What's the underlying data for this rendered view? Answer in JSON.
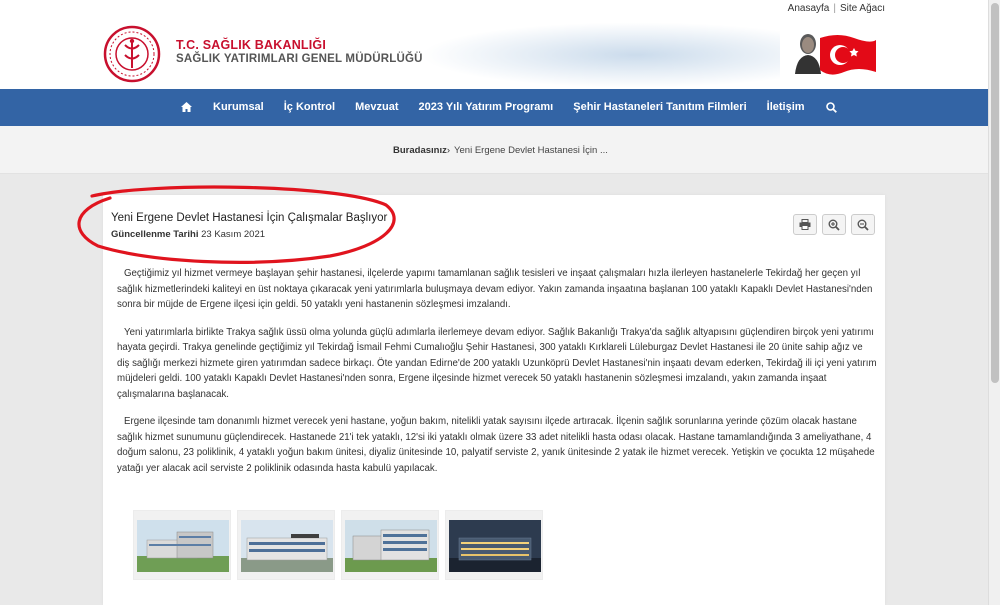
{
  "top_links": {
    "home": "Anasayfa",
    "sitemap": "Site Ağacı"
  },
  "brand": {
    "line1": "T.C. SAĞLIK BAKANLIĞI",
    "line2": "SAĞLIK YATIRIMLARI GENEL MÜDÜRLÜĞÜ"
  },
  "nav": {
    "items": [
      "Kurumsal",
      "İç Kontrol",
      "Mevzuat",
      "2023 Yılı Yatırım Programı",
      "Şehir Hastaneleri Tanıtım Filmleri",
      "İletişim"
    ],
    "home_icon": "home-icon",
    "search_icon": "search-icon"
  },
  "breadcrumb": {
    "label": "Buradasınız",
    "current": "Yeni Ergene Devlet Hastanesi İçin ..."
  },
  "article": {
    "title": "Yeni Ergene Devlet Hastanesi İçin Çalışmalar Başlıyor",
    "date_label": "Güncellenme Tarihi",
    "date_value": "23 Kasım 2021",
    "paragraphs": [
      "Geçtiğimiz yıl hizmet vermeye başlayan şehir hastanesi, ilçelerde yapımı tamamlanan sağlık tesisleri ve inşaat çalışmaları hızla ilerleyen hastanelerle Tekirdağ her geçen yıl sağlık hizmetlerindeki kaliteyi en üst noktaya çıkaracak yeni yatırımlarla buluşmaya devam ediyor. Yakın zamanda inşaatına başlanan 100 yataklı Kapaklı Devlet Hastanesi'nden sonra bir müjde de Ergene ilçesi için geldi. 50 yataklı yeni hastanenin sözleşmesi imzalandı.",
      "Yeni yatırımlarla birlikte Trakya sağlık üssü olma yolunda güçlü adımlarla ilerlemeye devam ediyor. Sağlık Bakanlığı Trakya'da sağlık altyapısını güçlendiren birçok yeni yatırımı hayata geçirdi. Trakya genelinde geçtiğimiz yıl Tekirdağ İsmail Fehmi Cumalıoğlu Şehir Hastanesi, 300 yataklı Kırklareli Lüleburgaz Devlet Hastanesi ile 20 ünite sahip ağız ve diş sağlığı merkezi hizmete giren yatırımdan sadece birkaçı. Öte yandan Edirne'de 200 yataklı Uzunköprü Devlet Hastanesi'nin inşaatı devam ederken, Tekirdağ ili içi yeni yatırım müjdeleri geldi. 100 yataklı Kapaklı Devlet Hastanesi'nden sonra, Ergene ilçesinde hizmet verecek 50 yataklı hastanenin sözleşmesi imzalandı, yakın zamanda inşaat çalışmalarına başlanacak.",
      "Ergene ilçesinde tam donanımlı hizmet verecek yeni hastane, yoğun bakım, nitelikli yatak sayısını ilçede artıracak. İlçenin sağlık sorunlarına yerinde çözüm olacak hastane sağlık hizmet sunumunu güçlendirecek. Hastanede 21'i tek yataklı, 12'si iki yataklı olmak üzere 33 adet nitelikli hasta odası olacak. Hastane tamamlandığında 3 ameliyathane, 4 doğum salonu, 23 poliklinik, 4 yataklı yoğun bakım ünitesi, diyaliz ünitesinde 10, palyatif serviste 2, yanık ünitesinde 2 yatak ile hizmet verecek. Yetişkin ve çocukta 12 müşahede yatağı yer alacak acil serviste 2 poliklinik odasında hasta kabulü yapılacak."
    ]
  },
  "tools": [
    "print-icon",
    "zoom-in-icon",
    "zoom-out-icon"
  ],
  "gallery_count": 4,
  "colors": {
    "nav": "#3364a5",
    "brand_red": "#c8102e",
    "annotation": "#e0141e"
  }
}
